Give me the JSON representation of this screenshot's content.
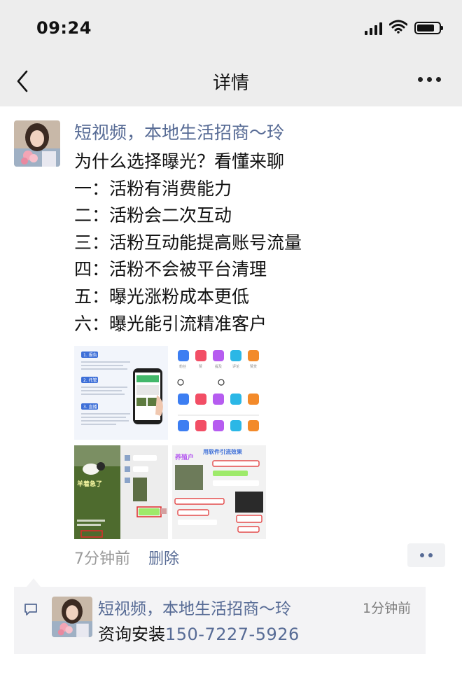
{
  "status_bar": {
    "time": "09:24",
    "icons": [
      "signal-icon",
      "wifi-icon",
      "battery-icon"
    ]
  },
  "nav": {
    "title": "详情",
    "back_icon": "chevron-left-icon",
    "more_icon": "more-icon"
  },
  "post": {
    "author": "短视频，本地生活招商～玲",
    "lines": [
      "为什么选择曝光？看懂来聊",
      "一：活粉有消费能力",
      "二：活粉会二次互动",
      "三：活粉互动能提高账号流量",
      "四：活粉不会被平台清理",
      "五：曝光涨粉成本更低",
      "六：曝光能引流精准客户"
    ],
    "images": [
      {
        "name": "step-guide-image",
        "text": [
          "1. 报告",
          "2. 托管",
          "3. 直播"
        ]
      },
      {
        "name": "interaction-icons-image",
        "labels": [
          "粉丝",
          "赞",
          "提及",
          "评论",
          "赞赏"
        ]
      },
      {
        "name": "video-screenshot-image",
        "overlay": "羊着急了"
      },
      {
        "name": "traffic-effect-image",
        "headline": "用软件引流效果",
        "tag": "养殖户"
      }
    ],
    "time_ago": "7分钟前",
    "delete_label": "删除"
  },
  "comment": {
    "author": "短视频，本地生活招商～玲",
    "time_ago": "1分钟前",
    "text_prefix": "资询安装",
    "phone": "150-7227-5926"
  },
  "colors": {
    "link": "#576b95",
    "nav_bg": "#ededed",
    "comment_bg": "#f3f3f5",
    "meta": "#9a9a9a"
  }
}
